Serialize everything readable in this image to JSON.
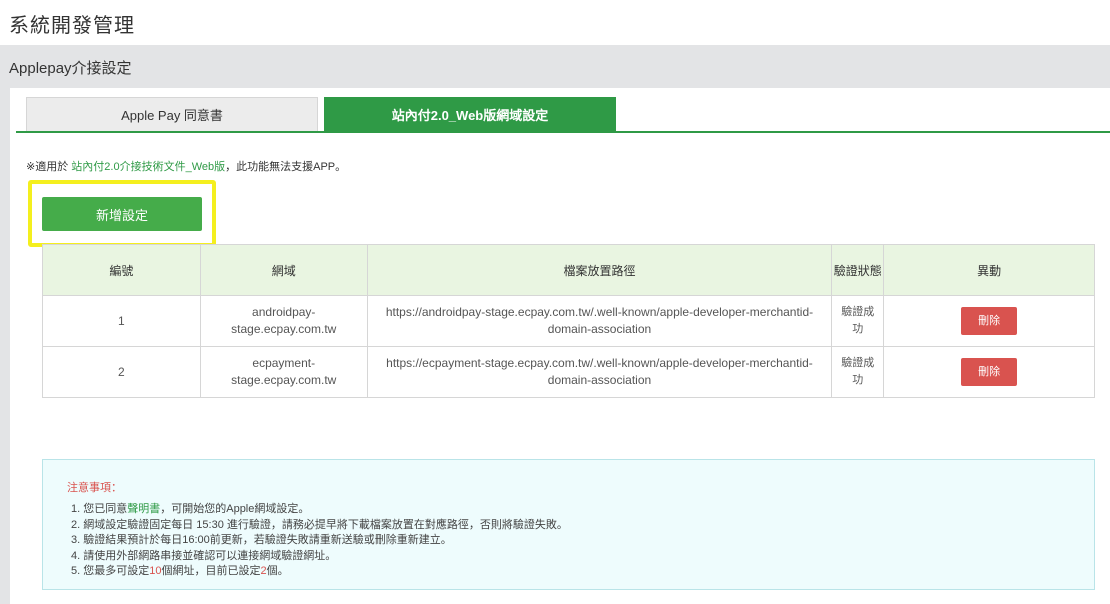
{
  "page_title": "系統開發管理",
  "panel_header": "Applepay介接設定",
  "tabs": [
    {
      "label": "Apple Pay 同意書",
      "active": false
    },
    {
      "label": "站內付2.0_Web版網域設定",
      "active": true
    }
  ],
  "note": {
    "prefix": "※適用於 ",
    "link": "站內付2.0介接技術文件_Web版",
    "suffix": "，此功能無法支援APP。"
  },
  "add_button": "新增設定",
  "table": {
    "headers": [
      "編號",
      "網域",
      "檔案放置路徑",
      "驗證狀態",
      "異動"
    ],
    "rows": [
      {
        "no": "1",
        "domain": "androidpay-stage.ecpay.com.tw",
        "path": "https://androidpay-stage.ecpay.com.tw/.well-known/apple-developer-merchantid-domain-association",
        "status": "驗證成功",
        "action": "刪除"
      },
      {
        "no": "2",
        "domain": "ecpayment-stage.ecpay.com.tw",
        "path": "https://ecpayment-stage.ecpay.com.tw/.well-known/apple-developer-merchantid-domain-association",
        "status": "驗證成功",
        "action": "刪除"
      }
    ]
  },
  "notice": {
    "title": "注意事項：",
    "item1_a": "1. 您已同意",
    "item1_link": "聲明書",
    "item1_b": "，可開始您的Apple網域設定。",
    "item2": "2. 網域設定驗證固定每日 15:30 進行驗證，請務必提早將下載檔案放置在對應路徑，否則將驗證失敗。",
    "item3": "3. 驗證結果預計於每日16:00前更新，若驗證失敗請重新送驗或刪除重新建立。",
    "item4": "4. 請使用外部網路串接並確認可以連接網域驗證網址。",
    "item5_a": "5. 您最多可設定",
    "item5_max": "10",
    "item5_b": "個網址，目前已設定",
    "item5_count": "2",
    "item5_c": "個。"
  },
  "colors": {
    "accent": "#2f9a46",
    "button": "#45ac4a",
    "danger": "#d9534f",
    "highlight": "#f4ef1e"
  }
}
